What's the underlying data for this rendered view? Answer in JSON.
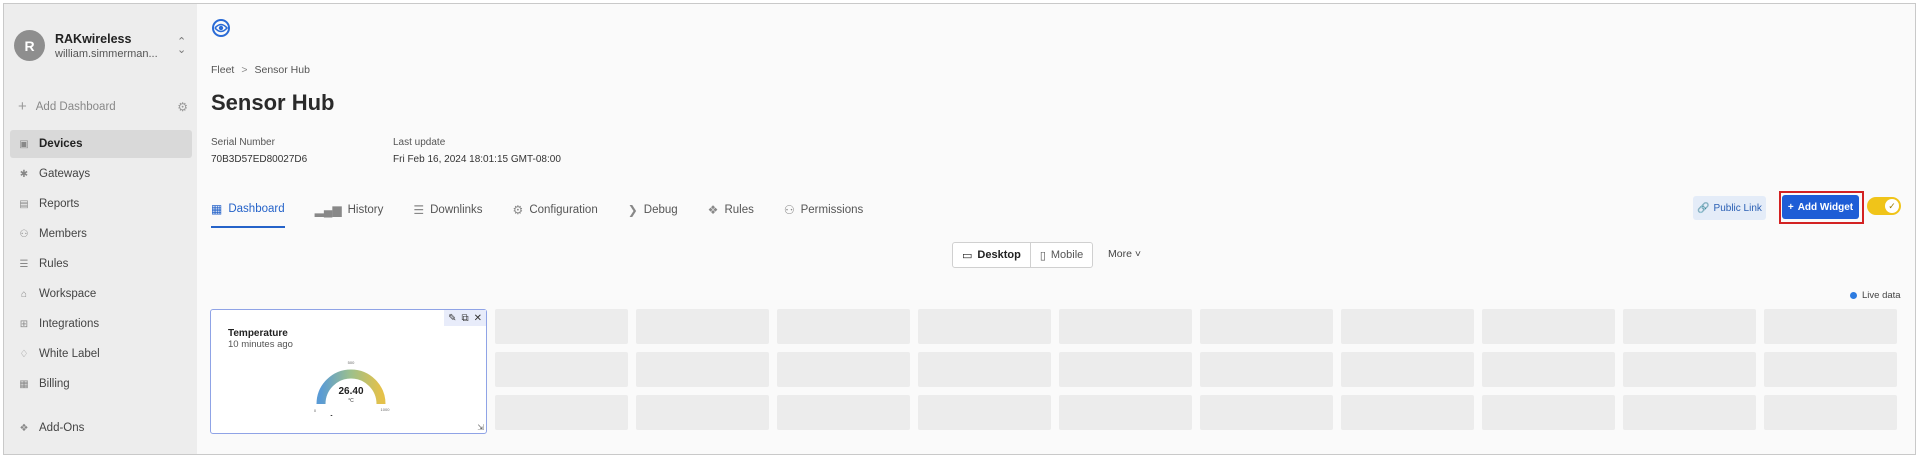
{
  "sidebar": {
    "org": {
      "initial": "R",
      "name": "RAKwireless",
      "email": "william.simmerman..."
    },
    "add_dashboard": "Add Dashboard",
    "items": [
      {
        "label": "Devices",
        "icon": "devices-icon"
      },
      {
        "label": "Gateways",
        "icon": "gateway-icon"
      },
      {
        "label": "Reports",
        "icon": "report-icon"
      },
      {
        "label": "Members",
        "icon": "members-icon"
      },
      {
        "label": "Rules",
        "icon": "rules-icon"
      },
      {
        "label": "Workspace",
        "icon": "home-icon"
      },
      {
        "label": "Integrations",
        "icon": "grid-icon"
      },
      {
        "label": "White Label",
        "icon": "tag-icon"
      },
      {
        "label": "Billing",
        "icon": "billing-icon"
      },
      {
        "label": "Add-Ons",
        "icon": "addons-icon"
      }
    ]
  },
  "breadcrumb": {
    "root": "Fleet",
    "separator": ">",
    "current": "Sensor Hub"
  },
  "title": "Sensor Hub",
  "meta": {
    "serial_label": "Serial Number",
    "serial_value": "70B3D57ED80027D6",
    "update_label": "Last update",
    "update_value": "Fri Feb 16, 2024 18:01:15 GMT-08:00"
  },
  "tabs": [
    {
      "label": "Dashboard",
      "icon": "table-icon"
    },
    {
      "label": "History",
      "icon": "bar-chart-icon"
    },
    {
      "label": "Downlinks",
      "icon": "sliders-icon"
    },
    {
      "label": "Configuration",
      "icon": "gear-icon"
    },
    {
      "label": "Debug",
      "icon": "rss-icon"
    },
    {
      "label": "Rules",
      "icon": "rules-icon"
    },
    {
      "label": "Permissions",
      "icon": "users-icon"
    }
  ],
  "actions": {
    "public_link": "Public Link",
    "add_widget": "Add Widget"
  },
  "view": {
    "desktop": "Desktop",
    "mobile": "Mobile",
    "more": "More"
  },
  "live_data": "Live data",
  "widget": {
    "title": "Temperature",
    "subtitle": "10 minutes ago",
    "value": "26.40",
    "unit": "°C",
    "min": "0",
    "mid": "500",
    "max": "1000",
    "fraction": 0.0264
  },
  "colors": {
    "accent": "#2563c9",
    "button": "#1e5dd6",
    "highlight": "#d32222",
    "toggle": "#f0c419"
  }
}
